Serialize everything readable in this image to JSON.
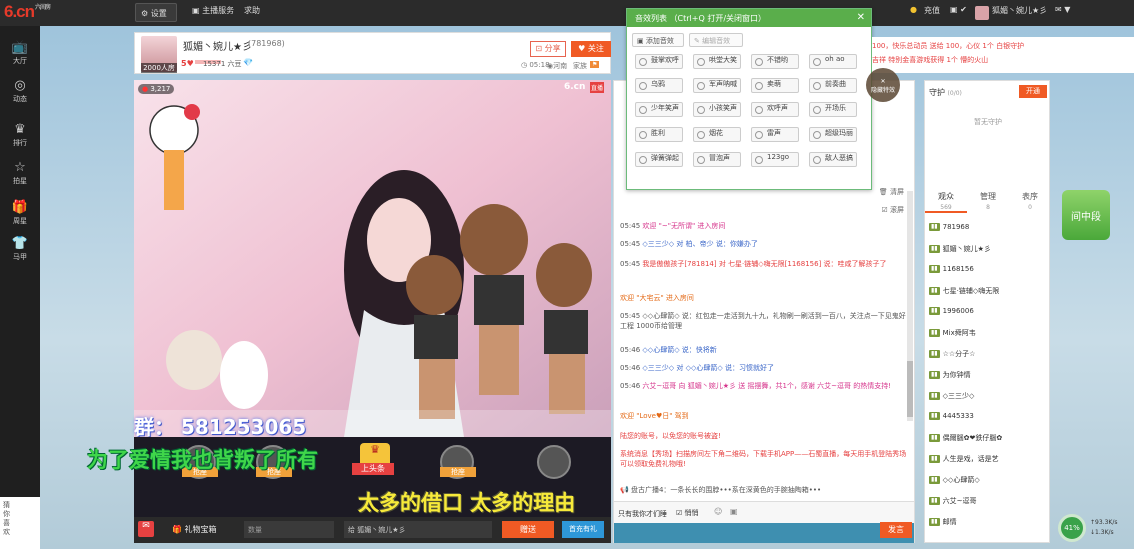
{
  "topbar": {
    "logo": "6.cn",
    "logo_sub": "六间房",
    "settings": "设置",
    "host_service": "主播服务",
    "help": "求助",
    "recharge": "充值",
    "username": "狐媚丶婉儿★彡"
  },
  "nav": [
    {
      "label": "大厅",
      "icon": "tv"
    },
    {
      "label": "动态",
      "icon": "compass"
    },
    {
      "label": "排行",
      "icon": "crown"
    },
    {
      "label": "拍星",
      "icon": "star"
    },
    {
      "label": "周星",
      "icon": "gift"
    },
    {
      "label": "马甲",
      "icon": "shirt"
    }
  ],
  "host": {
    "name": "狐媚丶婉儿★彡",
    "id": "(781968)",
    "fans_badge": "2000人房",
    "level": "5",
    "beans": "15371 六豆",
    "share": "分享",
    "follow": "关注",
    "time": "05:18",
    "region": "河南",
    "family": "家族"
  },
  "video": {
    "viewers": "3,217",
    "platform": "6.cn",
    "live": "直播",
    "contact": "群： 581253065",
    "lyric1": "为了爱情我也背叛了所有",
    "lyric2": "太多的借口 太多的理由",
    "headline": "上头条"
  },
  "seats": [
    "抢座",
    "抢座",
    "抢座"
  ],
  "giftbar": {
    "gift_box": "礼物宝箱",
    "qty_placeholder": "数量",
    "recipient": "给 狐媚丶婉儿★彡",
    "send": "赠送",
    "first_recharge": "首充有礼"
  },
  "sfx_popup": {
    "title": "音效列表",
    "hint": "（Ctrl+Q 打开/关闭窗口）",
    "add": "添加音效",
    "edit": "编辑音效",
    "items": [
      "鼓掌欢呼",
      "哄堂大笑",
      "不错哟",
      "oh ao",
      "乌鸦",
      "军声呐喊",
      "卖萌",
      "前奏曲",
      "少年笑声",
      "小孩笑声",
      "欢呼声",
      "开场乐",
      "胜利",
      "烟花",
      "雷声",
      "超级玛丽",
      "弹簧弹起",
      "冒泡声",
      "123go",
      "敌人恶搞"
    ]
  },
  "news": {
    "line1": "100，快乐总动员 送给 100，心仪 1个 白银守护",
    "line2": "吉祥 特别金喜游戏获得 1个 懵的火山",
    "effects": "隐藏特效"
  },
  "chat": {
    "clear": "清屏",
    "scroll": "滚屏",
    "msgs": [
      {
        "t": "05:45",
        "text": "欢迎 \"~\"无所谓\" 进入房间"
      },
      {
        "t": "05:45",
        "text": "◇三三少◇ 对 柏、帝少 说：你嫌办了"
      },
      {
        "t": "05:45",
        "text": "我是傲傲孩子[781814] 对 七星·链辅◇嗨无限[1168156] 说：哇咸了解孩子了"
      },
      {
        "t": "",
        "text": "欢迎 \"大宅云\" 进入房间"
      },
      {
        "t": "05:45",
        "text": "◇◇心肆箭◇ 说：红包走一走活到九十九，礼物刷一刷活到一百八，关注点一下见鬼好工程 1000币给管理"
      },
      {
        "t": "05:46",
        "text": "◇◇心肆箭◇ 说：快将新"
      },
      {
        "t": "05:46",
        "text": "◇三三少◇ 对 ◇◇心肆箭◇ 说：习惯就好了"
      },
      {
        "t": "05:46",
        "text": "六艾~逗哥 向 狐媚丶婉儿★彡 送 摇摆舞，共1个，感谢 六艾~逗哥 的热情支持!"
      },
      {
        "t": "",
        "text": "欢迎 \"Love♥日\" 驾到"
      },
      {
        "t": "",
        "text": "陆您的账号，以免您的账号被盗!"
      },
      {
        "t": "",
        "text": "系统消息【秀场】扫描房间左下角二维码，下载手机APP——石蜀直播，每天用手机登陆秀场可以领取免费礼物哦!"
      },
      {
        "t": "",
        "text": "盘古广播4：一条长长的围脖•••系在深黄色的手腕抽陶箱•••"
      }
    ],
    "input_hint": "只有我你才们睡",
    "quiet": "悄悄",
    "send": "发言"
  },
  "guard": {
    "title": "守护",
    "count": "(0/0)",
    "open": "开通",
    "empty": "暂无守护"
  },
  "audience": {
    "tabs": [
      {
        "label": "观众",
        "count": "569"
      },
      {
        "label": "管理",
        "count": "8"
      },
      {
        "label": "表序",
        "count": "0"
      }
    ],
    "users": [
      {
        "lv": "5",
        "name": "781968"
      },
      {
        "lv": "",
        "name": "狐媚丶婉儿★彡"
      },
      {
        "lv": "",
        "name": "1168156"
      },
      {
        "lv": "",
        "name": "七星·链辅◇嗨无限"
      },
      {
        "lv": "",
        "name": "1996006"
      },
      {
        "lv": "",
        "name": "Mix舜阿韦"
      },
      {
        "lv": "",
        "name": "☆☆分子☆"
      },
      {
        "lv": "",
        "name": "为你钟情"
      },
      {
        "lv": "",
        "name": "◇三三少◇"
      },
      {
        "lv": "",
        "name": "4445333"
      },
      {
        "lv": "",
        "name": "偶爾腦✿❤鉄仔腦✿"
      },
      {
        "lv": "",
        "name": "人生是戏，话是艺"
      },
      {
        "lv": "",
        "name": "◇◇心肆箭◇"
      },
      {
        "lv": "",
        "name": "六艾~逗哥"
      },
      {
        "lv": "",
        "name": "邮情"
      }
    ]
  },
  "ad": {
    "text": "间中段"
  },
  "network": {
    "percent": "41%",
    "up": "93.3K/s",
    "down": "1.3K/s"
  },
  "edge": {
    "text": "猜你喜欢"
  }
}
